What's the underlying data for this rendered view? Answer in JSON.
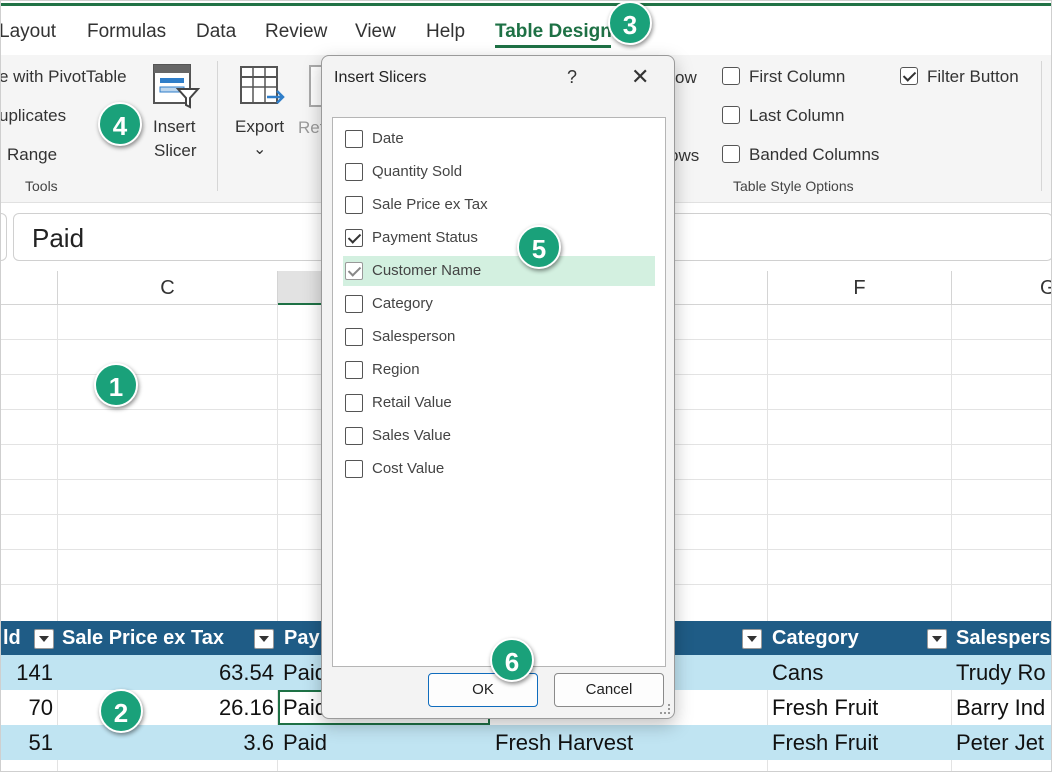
{
  "menu_tabs": [
    "Layout",
    "Formulas",
    "Data",
    "Review",
    "View",
    "Help",
    "Table Design"
  ],
  "ribbon": {
    "tools_items": [
      "e with PivotTable",
      "uplicates",
      "Range"
    ],
    "tools_group_label": "Tools",
    "insert_slicer_label": [
      "Insert",
      "Slicer"
    ],
    "export_label": "Export",
    "export_chevron": "⌄",
    "refresh_partial": "Ref",
    "partial_row_1": "ow",
    "partial_row_3": "ows",
    "style_options": [
      {
        "label": "First Column",
        "checked": false
      },
      {
        "label": "Filter Button",
        "checked": true
      },
      {
        "label": "Last Column",
        "checked": false
      },
      {
        "label": "Banded Columns",
        "checked": false
      }
    ],
    "style_group_label": "Table Style Options"
  },
  "formula_bar": {
    "value": "Paid"
  },
  "columns": {
    "c": "C",
    "f": "F",
    "g": "G"
  },
  "table": {
    "headers": [
      "ld",
      "Sale Price ex Tax",
      "Pay",
      "Category",
      "Salespers"
    ],
    "rows": [
      {
        "qty": "141",
        "price": "63.54",
        "status": "Paid",
        "customer": "",
        "category": "Cans",
        "salesperson": "Trudy Ro"
      },
      {
        "qty": "70",
        "price": "26.16",
        "status": "Paid",
        "customer": "",
        "category": "Fresh Fruit",
        "salesperson": "Barry Ind"
      },
      {
        "qty": "51",
        "price": "3.6",
        "status": "Paid",
        "customer": "Fresh Harvest",
        "category": "Fresh Fruit",
        "salesperson": "Peter Jet"
      }
    ]
  },
  "dialog": {
    "title": "Insert Slicers",
    "help": "?",
    "close": "✕",
    "fields": [
      {
        "label": "Date",
        "checked": false
      },
      {
        "label": "Quantity Sold",
        "checked": false
      },
      {
        "label": "Sale Price ex Tax",
        "checked": false
      },
      {
        "label": "Payment Status",
        "checked": true
      },
      {
        "label": "Customer Name",
        "checked": true,
        "highlight": true
      },
      {
        "label": "Category",
        "checked": false
      },
      {
        "label": "Salesperson",
        "checked": false
      },
      {
        "label": "Region",
        "checked": false
      },
      {
        "label": "Retail Value",
        "checked": false
      },
      {
        "label": "Sales Value",
        "checked": false
      },
      {
        "label": "Cost Value",
        "checked": false
      }
    ],
    "ok_label": "OK",
    "cancel_label": "Cancel"
  },
  "badges": [
    "1",
    "2",
    "3",
    "4",
    "5",
    "6"
  ],
  "colors": {
    "accent": "#1e7145",
    "table_header": "#1f5c86",
    "band": "#c0e4f2",
    "badge": "#1aa17a",
    "highlight": "#d3f0e0"
  }
}
